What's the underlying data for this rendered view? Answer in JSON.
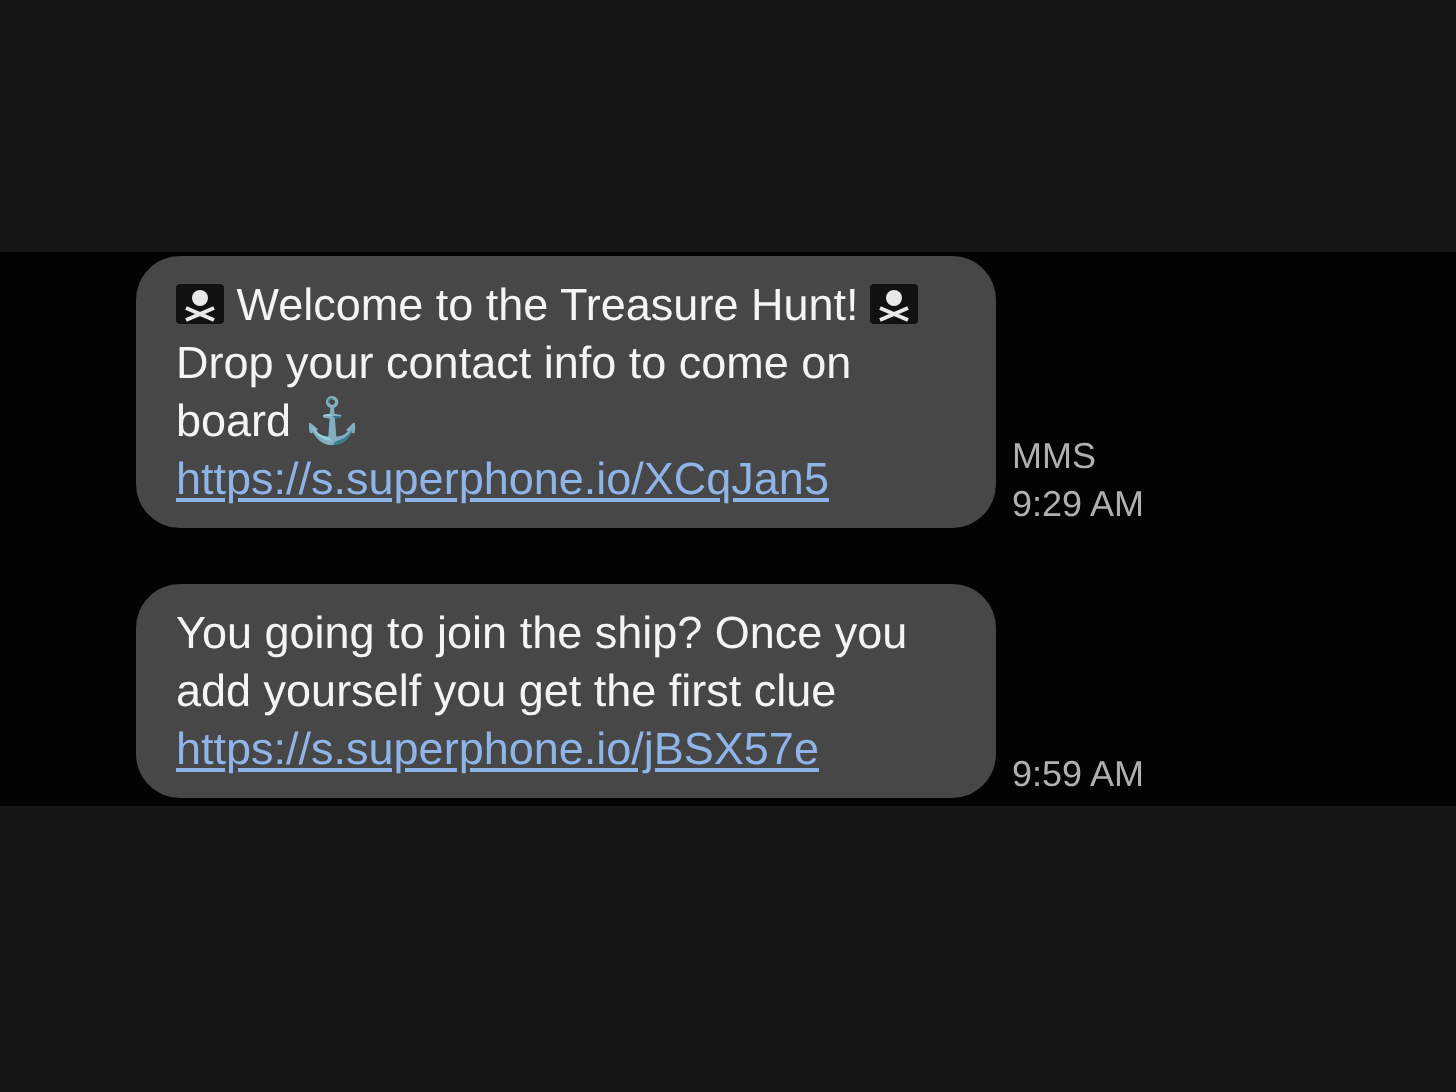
{
  "messages": [
    {
      "parts": [
        {
          "kind": "icon"
        },
        {
          "kind": "text",
          "text": " Welcome to the Treasure Hunt! "
        },
        {
          "kind": "icon"
        },
        {
          "kind": "text",
          "text": " Drop your contact info to come on board ⚓ "
        },
        {
          "kind": "link",
          "text": "https://s.superphone.io/XCqJan5"
        }
      ],
      "type_label": "MMS",
      "time": "9:29 AM"
    },
    {
      "parts": [
        {
          "kind": "text",
          "text": "You going to join the ship? Once you add yourself you get the first clue "
        },
        {
          "kind": "link",
          "text": "https://s.superphone.io/jBSX57e"
        }
      ],
      "time": "9:59 AM"
    }
  ]
}
